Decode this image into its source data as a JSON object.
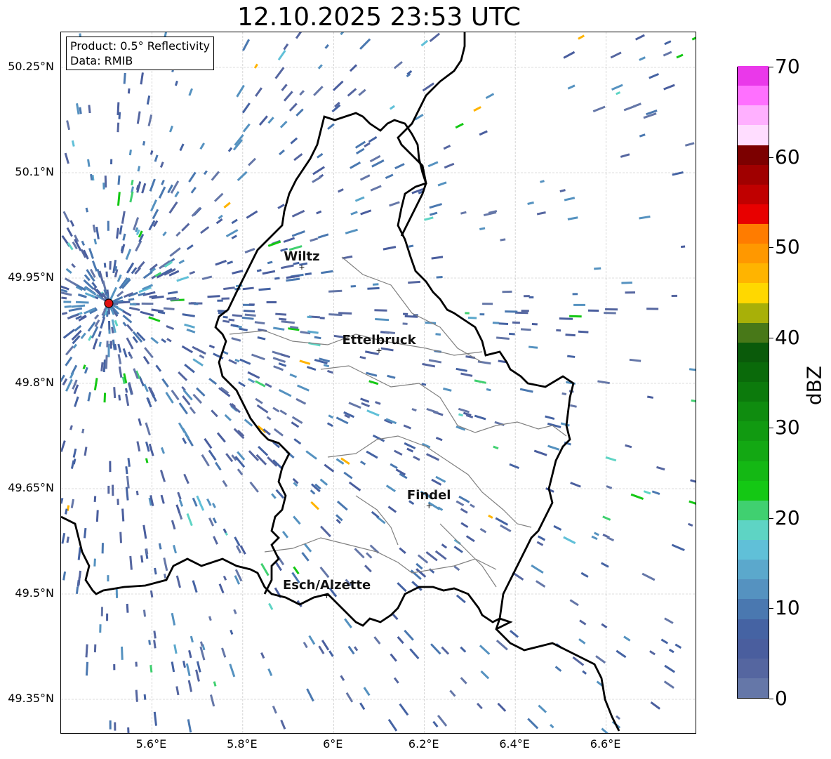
{
  "title": "12.10.2025 23:53 UTC",
  "info": {
    "product": "Product: 0.5° Reflectivity",
    "data": "Data: RMIB"
  },
  "map": {
    "lon_range": [
      5.4,
      6.8
    ],
    "lat_range": [
      49.3,
      50.3
    ],
    "y_ticks": [
      {
        "label": "50.25°N",
        "lat": 50.25
      },
      {
        "label": "50.1°N",
        "lat": 50.1
      },
      {
        "label": "49.95°N",
        "lat": 49.95
      },
      {
        "label": "49.8°N",
        "lat": 49.8
      },
      {
        "label": "49.65°N",
        "lat": 49.65
      },
      {
        "label": "49.5°N",
        "lat": 49.5
      },
      {
        "label": "49.35°N",
        "lat": 49.35
      }
    ],
    "x_ticks": [
      {
        "label": "5.6°E",
        "lon": 5.6
      },
      {
        "label": "5.8°E",
        "lon": 5.8
      },
      {
        "label": "6°E",
        "lon": 6.0
      },
      {
        "label": "6.2°E",
        "lon": 6.2
      },
      {
        "label": "6.4°E",
        "lon": 6.4
      },
      {
        "label": "6.6°E",
        "lon": 6.6
      }
    ],
    "radar_site": {
      "lon": 5.505,
      "lat": 49.914
    },
    "cities": [
      {
        "name": "Wiltz",
        "lon": 5.93,
        "lat": 49.966
      },
      {
        "name": "Ettelbruck",
        "lon": 6.1,
        "lat": 49.847
      },
      {
        "name": "Findel",
        "lon": 6.21,
        "lat": 49.626
      },
      {
        "name": "Esch/Alzette",
        "lon": 5.985,
        "lat": 49.498
      }
    ]
  },
  "colorbar": {
    "label": "dBZ",
    "min": 0,
    "max": 70,
    "ticks": [
      "0",
      "10",
      "20",
      "30",
      "40",
      "50",
      "60",
      "70"
    ],
    "colors": [
      "#6577a8",
      "#5566a0",
      "#4a5e9e",
      "#4563a3",
      "#4a78b0",
      "#5592c0",
      "#5ba8cc",
      "#60c0d8",
      "#5ed4c4",
      "#40d070",
      "#14c814",
      "#14b814",
      "#13a813",
      "#119a11",
      "#0f8c0f",
      "#0c7a0c",
      "#0a6a0a",
      "#0a5a0a",
      "#487818",
      "#a8b008",
      "#ffd800",
      "#ffb400",
      "#ff9800",
      "#ff7c00",
      "#e80000",
      "#c00000",
      "#a00000",
      "#7c0000",
      "#ffddff",
      "#ffb0ff",
      "#ff70ff",
      "#ea38ea"
    ]
  }
}
